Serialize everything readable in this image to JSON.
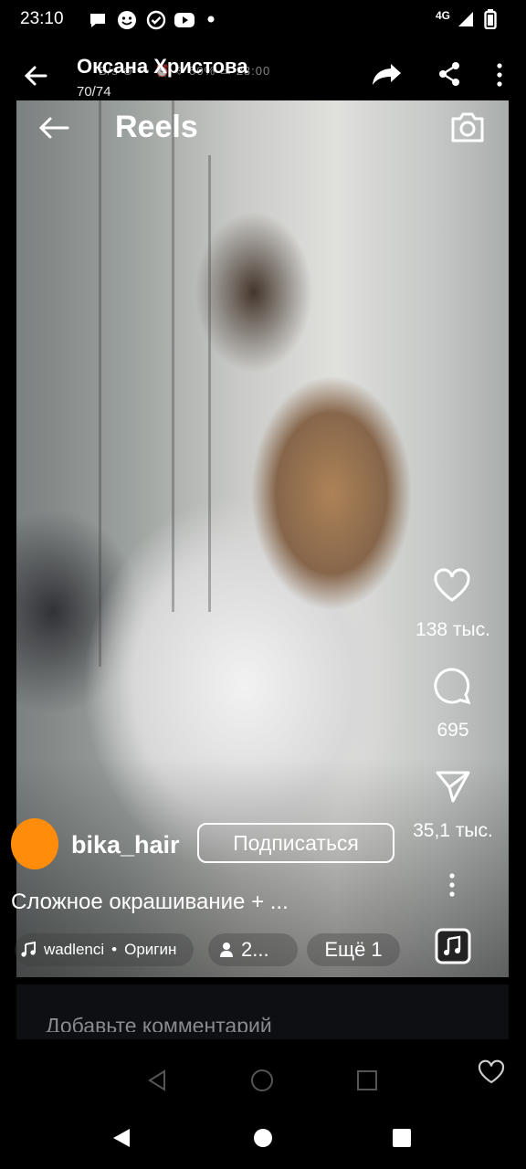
{
  "status_bar": {
    "time": "23:10",
    "network": "4G"
  },
  "viewer": {
    "contact_name": "Оксана Христова",
    "counter": "70/74",
    "ghost_strip": "B/s  ⊕ ⊶ ⏰ ⟐ 50% ▭ 23:00"
  },
  "reel": {
    "title": "Reels",
    "likes": "138 тыс.",
    "comments": "695",
    "shares": "35,1 тыс.",
    "username": "bika_hair",
    "follow_label": "Подписаться",
    "caption": "Сложное окрашивание + ...",
    "audio_artist": "wadlenci",
    "audio_sep": "•",
    "audio_title": "Оригин",
    "people_count": "2...",
    "more_label": "Ещё 1"
  },
  "comment": {
    "placeholder": "Добавьте комментарий"
  },
  "colors": {
    "avatar": "#ff8c0a",
    "background": "#000000"
  }
}
